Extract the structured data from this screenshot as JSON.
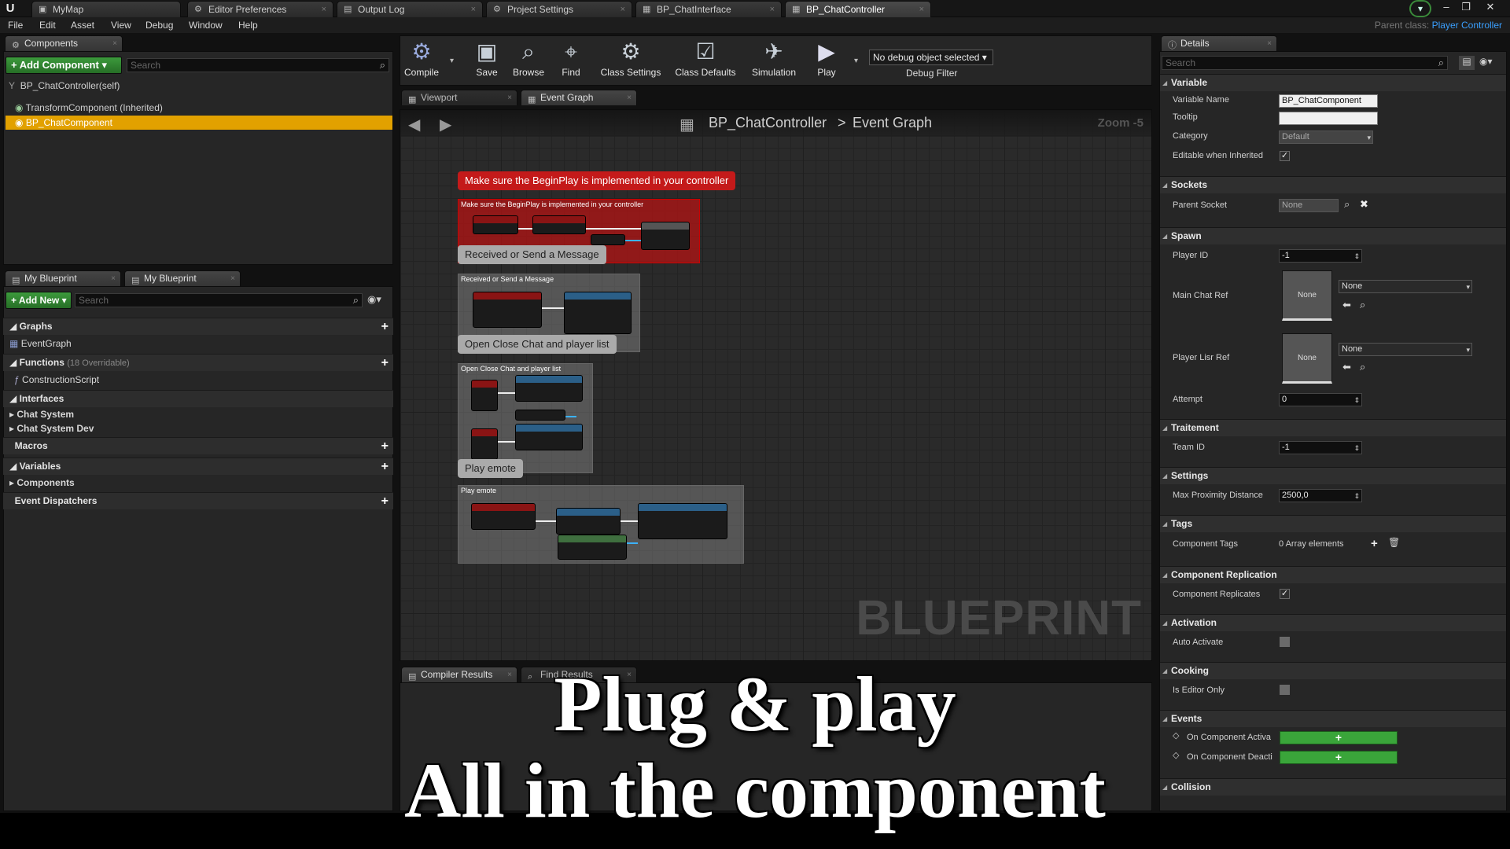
{
  "title_bar": {
    "tabs": [
      {
        "label": "MyMap"
      },
      {
        "label": "Editor Preferences"
      },
      {
        "label": "Output Log"
      },
      {
        "label": "Project Settings"
      },
      {
        "label": "BP_ChatInterface"
      },
      {
        "label": "BP_ChatController"
      }
    ]
  },
  "menu": {
    "items": [
      "File",
      "Edit",
      "Asset",
      "View",
      "Debug",
      "Window",
      "Help"
    ],
    "parent_class_label": "Parent class:",
    "parent_class_value": "Player Controller"
  },
  "components": {
    "tab_label": "Components",
    "add_button": "+ Add Component",
    "search_placeholder": "Search",
    "root": "BP_ChatController(self)",
    "items": [
      "TransformComponent (Inherited)",
      "BP_ChatComponent"
    ]
  },
  "my_blueprint": {
    "tab1": "My Blueprint",
    "tab2": "My Blueprint",
    "add_new": "+ Add New",
    "search_placeholder": "Search",
    "graphs": "Graphs",
    "event_graph": "EventGraph",
    "functions": "Functions",
    "functions_note": "(18 Overridable)",
    "construction_script": "ConstructionScript",
    "interfaces": "Interfaces",
    "interface_items": [
      "Chat System",
      "Chat System Dev"
    ],
    "macros": "Macros",
    "variables": "Variables",
    "variable_items": [
      "Components"
    ],
    "event_dispatchers": "Event Dispatchers"
  },
  "toolbar": {
    "compile": "Compile",
    "save": "Save",
    "browse": "Browse",
    "find": "Find",
    "class_settings": "Class Settings",
    "class_defaults": "Class Defaults",
    "simulation": "Simulation",
    "play": "Play",
    "debug_selected": "No debug object selected",
    "debug_filter": "Debug Filter"
  },
  "editor_tabs": {
    "viewport": "Viewport",
    "event_graph": "Event Graph"
  },
  "graph": {
    "breadcrumb_root": "BP_ChatController",
    "breadcrumb_sep": ">",
    "breadcrumb_leaf": "Event Graph",
    "zoom": "Zoom -5",
    "watermark": "BLUEPRINT",
    "comments": [
      {
        "bubble": "Make sure the BeginPlay is implemented in your controller",
        "header": "Make sure the BeginPlay is implemented in your controller"
      },
      {
        "bubble": "Received or Send a Message",
        "header": "Received or Send a Message"
      },
      {
        "bubble": "Open Close Chat and player list",
        "header": "Open Close Chat and player list"
      },
      {
        "bubble": "Play emote",
        "header": "Play emote"
      }
    ]
  },
  "bottom_tabs": {
    "compiler_results": "Compiler Results",
    "find_results": "Find Results"
  },
  "details": {
    "tab_label": "Details",
    "search_placeholder": "Search",
    "variable": {
      "title": "Variable",
      "name_label": "Variable Name",
      "name_value": "BP_ChatComponent",
      "tooltip_label": "Tooltip",
      "tooltip_value": "",
      "category_label": "Category",
      "category_value": "Default",
      "editable_label": "Editable when Inherited"
    },
    "sockets": {
      "title": "Sockets",
      "parent_socket_label": "Parent Socket",
      "parent_socket_value": "None"
    },
    "spawn": {
      "title": "Spawn",
      "player_id_label": "Player ID",
      "player_id_value": "-1",
      "main_chat_label": "Main Chat Ref",
      "main_chat_value": "None",
      "player_list_label": "Player Lisr Ref",
      "player_list_value": "None",
      "thumb_none": "None",
      "attempt_label": "Attempt",
      "attempt_value": "0"
    },
    "traitement": {
      "title": "Traitement",
      "team_id_label": "Team ID",
      "team_id_value": "-1"
    },
    "settings": {
      "title": "Settings",
      "max_prox_label": "Max Proximity Distance",
      "max_prox_value": "2500,0"
    },
    "tags": {
      "title": "Tags",
      "component_tags_label": "Component Tags",
      "component_tags_value": "0 Array elements"
    },
    "replication": {
      "title": "Component Replication",
      "replicates_label": "Component Replicates"
    },
    "activation": {
      "title": "Activation",
      "auto_activate_label": "Auto Activate"
    },
    "cooking": {
      "title": "Cooking",
      "editor_only_label": "Is Editor Only"
    },
    "events": {
      "title": "Events",
      "on_activate": "On Component Activa",
      "on_deactivate": "On Component Deacti"
    },
    "collision_partial": "Collision"
  },
  "overlay": {
    "line1": "Plug & play",
    "line2": "All in the component"
  },
  "colors": {
    "accent_blue": "#3aa0ff",
    "selection_orange": "#e2a100",
    "green_button": "#3aa53a",
    "comment_red": "#c41a1a"
  }
}
